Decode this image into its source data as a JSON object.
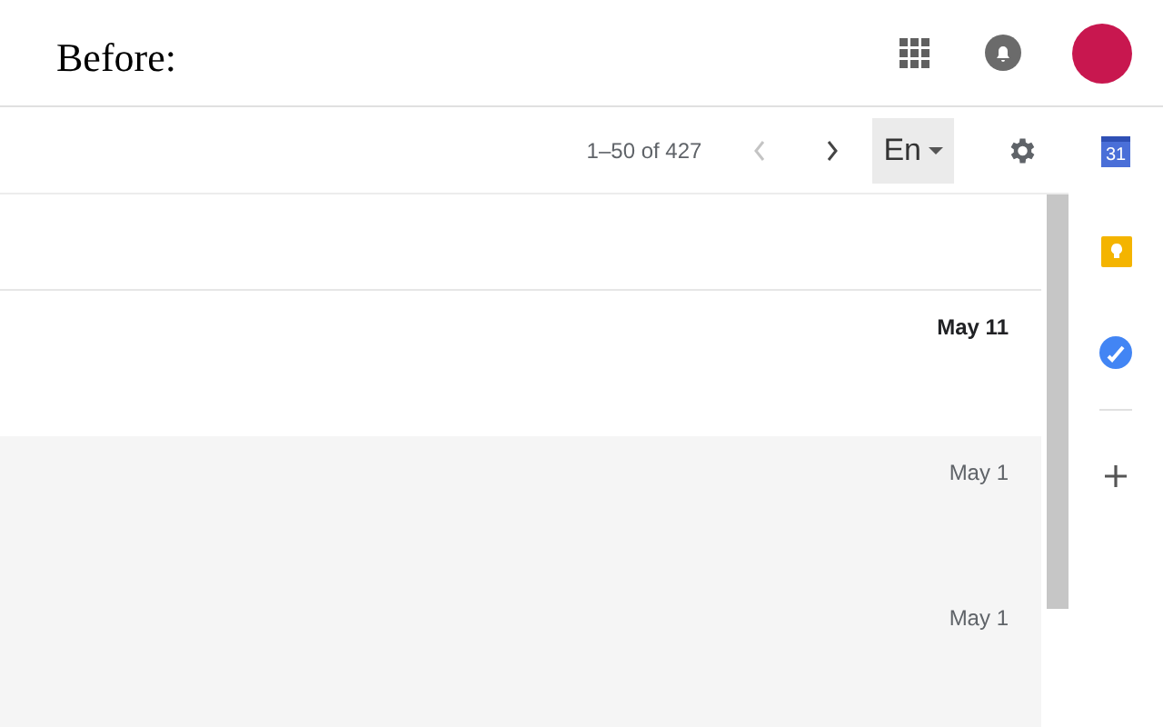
{
  "header": {
    "caption": "Before:"
  },
  "toolbar": {
    "range": "1–50 of 427",
    "language": "En",
    "prev_disabled": true,
    "next_disabled": false
  },
  "messages": [
    {
      "date": "May 11",
      "unread": true
    },
    {
      "date": "May 1",
      "unread": false
    },
    {
      "date": "May 1",
      "unread": false
    }
  ],
  "side_panel": {
    "calendar_day": "31"
  }
}
